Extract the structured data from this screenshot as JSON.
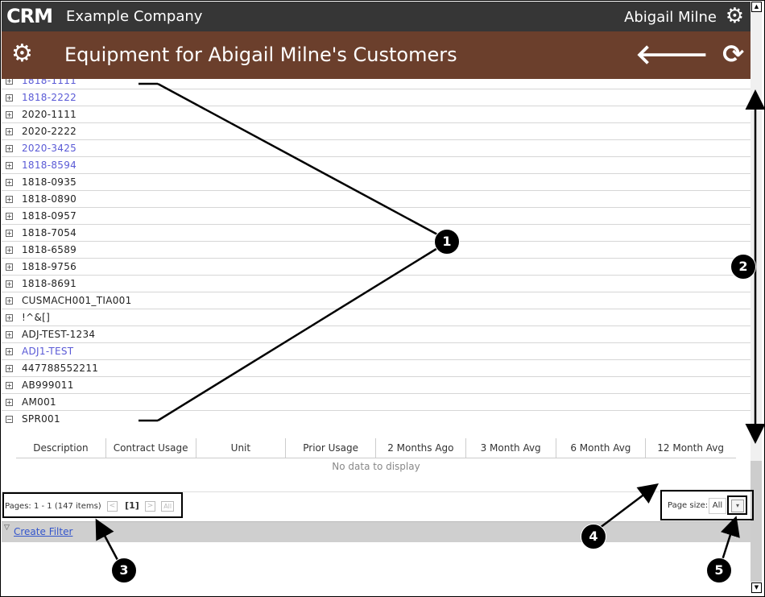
{
  "topbar": {
    "logo": "CRM",
    "company": "Example Company",
    "user": "Abigail Milne",
    "settings_icon": "gear-icon"
  },
  "header": {
    "title": "Equipment for Abigail Milne's Customers",
    "page_icon": "gears-icon",
    "back_icon": "arrow-left-icon",
    "refresh_icon": "refresh-icon"
  },
  "list": {
    "partial_row": {
      "label": "1818-1111",
      "link": true,
      "expanded": false
    },
    "rows": [
      {
        "label": "1818-2222",
        "link": true,
        "expanded": false
      },
      {
        "label": "2020-1111",
        "link": false,
        "expanded": false
      },
      {
        "label": "2020-2222",
        "link": false,
        "expanded": false
      },
      {
        "label": "2020-3425",
        "link": true,
        "expanded": false
      },
      {
        "label": "1818-8594",
        "link": true,
        "expanded": false
      },
      {
        "label": "1818-0935",
        "link": false,
        "expanded": false
      },
      {
        "label": "1818-0890",
        "link": false,
        "expanded": false
      },
      {
        "label": "1818-0957",
        "link": false,
        "expanded": false
      },
      {
        "label": "1818-7054",
        "link": false,
        "expanded": false
      },
      {
        "label": "1818-6589",
        "link": false,
        "expanded": false
      },
      {
        "label": "1818-9756",
        "link": false,
        "expanded": false
      },
      {
        "label": "1818-8691",
        "link": false,
        "expanded": false
      },
      {
        "label": "CUSMACH001_TIA001",
        "link": false,
        "expanded": false
      },
      {
        "label": "!^&[]",
        "link": false,
        "expanded": false
      },
      {
        "label": "ADJ-TEST-1234",
        "link": false,
        "expanded": false
      },
      {
        "label": "ADJ1-TEST",
        "link": true,
        "expanded": false
      },
      {
        "label": "447788552211",
        "link": false,
        "expanded": false
      },
      {
        "label": "AB999011",
        "link": false,
        "expanded": false
      },
      {
        "label": "AM001",
        "link": false,
        "expanded": false
      },
      {
        "label": "SPR001",
        "link": false,
        "expanded": true
      }
    ]
  },
  "detail_table": {
    "columns": [
      "Description",
      "Contract Usage",
      "Unit",
      "Prior Usage",
      "2 Months Ago",
      "3 Month Avg",
      "6 Month Avg",
      "12 Month Avg"
    ],
    "empty_text": "No data to display"
  },
  "pager": {
    "summary": "Pages: 1 - 1 (147 items)",
    "prev": "<",
    "current": "[1]",
    "next": ">",
    "all": "All"
  },
  "page_size": {
    "label": "Page size:",
    "value": "All"
  },
  "filter": {
    "link": "Create Filter",
    "icon": "filter-icon"
  },
  "callouts": [
    "1",
    "2",
    "3",
    "4",
    "5"
  ]
}
